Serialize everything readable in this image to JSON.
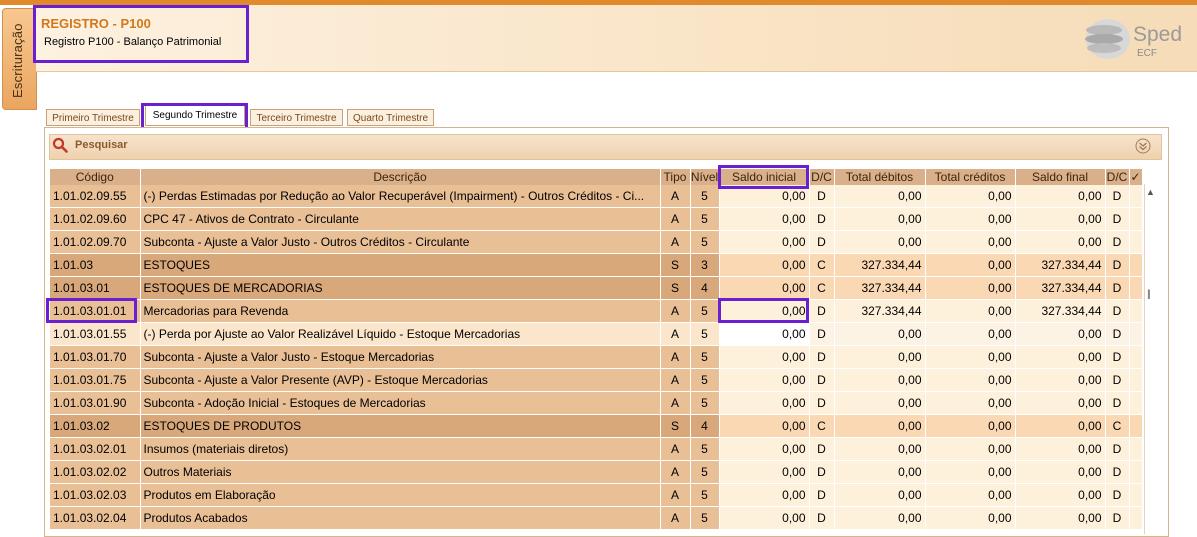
{
  "side_tab": {
    "label": "Escrituração"
  },
  "header": {
    "title": "REGISTRO - P100",
    "subtitle": "Registro P100 - Balanço Patrimonial",
    "logo_word": "Sped",
    "logo_sub": "ECF"
  },
  "tabs": [
    {
      "label": "Primeiro Trimestre",
      "active": false
    },
    {
      "label": "Segundo Trimestre",
      "active": true
    },
    {
      "label": "Terceiro Trimestre",
      "active": false
    },
    {
      "label": "Quarto Trimestre",
      "active": false
    }
  ],
  "search": {
    "label": "Pesquisar"
  },
  "table": {
    "columns": [
      "Código",
      "Descrição",
      "Tipo",
      "Nível",
      "Saldo inicial",
      "D/C",
      "Total débitos",
      "Total créditos",
      "Saldo final",
      "D/C",
      "✓"
    ],
    "rows": [
      {
        "codigo": "1.01.02.09.55",
        "descricao": "(-) Perdas Estimadas por Redução ao Valor Recuperável (Impairment) - Outros Créditos - Ci...",
        "tipo": "A",
        "nivel": "5",
        "saldo_inicial": "0,00",
        "dc1": "D",
        "total_debitos": "0,00",
        "total_creditos": "0,00",
        "saldo_final": "0,00",
        "dc2": "D",
        "style": "light"
      },
      {
        "codigo": "1.01.02.09.60",
        "descricao": "CPC 47 - Ativos de Contrato - Circulante",
        "tipo": "A",
        "nivel": "5",
        "saldo_inicial": "0,00",
        "dc1": "D",
        "total_debitos": "0,00",
        "total_creditos": "0,00",
        "saldo_final": "0,00",
        "dc2": "D",
        "style": "light"
      },
      {
        "codigo": "1.01.02.09.70",
        "descricao": "Subconta - Ajuste a Valor Justo - Outros Créditos - Circulante",
        "tipo": "A",
        "nivel": "5",
        "saldo_inicial": "0,00",
        "dc1": "D",
        "total_debitos": "0,00",
        "total_creditos": "0,00",
        "saldo_final": "0,00",
        "dc2": "D",
        "style": "light"
      },
      {
        "codigo": "1.01.03",
        "descricao": "ESTOQUES",
        "tipo": "S",
        "nivel": "3",
        "saldo_inicial": "0,00",
        "dc1": "C",
        "total_debitos": "327.334,44",
        "total_creditos": "0,00",
        "saldo_final": "327.334,44",
        "dc2": "D",
        "style": "dark"
      },
      {
        "codigo": "1.01.03.01",
        "descricao": "ESTOQUES DE MERCADORIAS",
        "tipo": "S",
        "nivel": "4",
        "saldo_inicial": "0,00",
        "dc1": "C",
        "total_debitos": "327.334,44",
        "total_creditos": "0,00",
        "saldo_final": "327.334,44",
        "dc2": "D",
        "style": "dark"
      },
      {
        "codigo": "1.01.03.01.01",
        "descricao": "Mercadorias para Revenda",
        "tipo": "A",
        "nivel": "5",
        "saldo_inicial": "0,00",
        "dc1": "D",
        "total_debitos": "327.334,44",
        "total_creditos": "0,00",
        "saldo_final": "327.334,44",
        "dc2": "D",
        "style": "light"
      },
      {
        "codigo": "1.01.03.01.55",
        "descricao": "(-) Perda por Ajuste ao Valor Realizável Líquido - Estoque Mercadorias",
        "tipo": "A",
        "nivel": "5",
        "saldo_inicial": "0,00",
        "dc1": "D",
        "total_debitos": "0,00",
        "total_creditos": "0,00",
        "saldo_final": "0,00",
        "dc2": "D",
        "style": "sel"
      },
      {
        "codigo": "1.01.03.01.70",
        "descricao": "Subconta - Ajuste a Valor Justo - Estoque Mercadorias",
        "tipo": "A",
        "nivel": "5",
        "saldo_inicial": "0,00",
        "dc1": "D",
        "total_debitos": "0,00",
        "total_creditos": "0,00",
        "saldo_final": "0,00",
        "dc2": "D",
        "style": "light"
      },
      {
        "codigo": "1.01.03.01.75",
        "descricao": "Subconta - Ajuste a Valor Presente (AVP) -  Estoque Mercadorias",
        "tipo": "A",
        "nivel": "5",
        "saldo_inicial": "0,00",
        "dc1": "D",
        "total_debitos": "0,00",
        "total_creditos": "0,00",
        "saldo_final": "0,00",
        "dc2": "D",
        "style": "light"
      },
      {
        "codigo": "1.01.03.01.90",
        "descricao": "Subconta - Adoção Inicial -  Estoques de Mercadorias",
        "tipo": "A",
        "nivel": "5",
        "saldo_inicial": "0,00",
        "dc1": "D",
        "total_debitos": "0,00",
        "total_creditos": "0,00",
        "saldo_final": "0,00",
        "dc2": "D",
        "style": "light"
      },
      {
        "codigo": "1.01.03.02",
        "descricao": "ESTOQUES DE PRODUTOS",
        "tipo": "S",
        "nivel": "4",
        "saldo_inicial": "0,00",
        "dc1": "C",
        "total_debitos": "0,00",
        "total_creditos": "0,00",
        "saldo_final": "0,00",
        "dc2": "C",
        "style": "dark"
      },
      {
        "codigo": "1.01.03.02.01",
        "descricao": "Insumos (materiais diretos)",
        "tipo": "A",
        "nivel": "5",
        "saldo_inicial": "0,00",
        "dc1": "D",
        "total_debitos": "0,00",
        "total_creditos": "0,00",
        "saldo_final": "0,00",
        "dc2": "D",
        "style": "light"
      },
      {
        "codigo": "1.01.03.02.02",
        "descricao": "Outros Materiais",
        "tipo": "A",
        "nivel": "5",
        "saldo_inicial": "0,00",
        "dc1": "D",
        "total_debitos": "0,00",
        "total_creditos": "0,00",
        "saldo_final": "0,00",
        "dc2": "D",
        "style": "light"
      },
      {
        "codigo": "1.01.03.02.03",
        "descricao": "Produtos em Elaboração",
        "tipo": "A",
        "nivel": "5",
        "saldo_inicial": "0,00",
        "dc1": "D",
        "total_debitos": "0,00",
        "total_creditos": "0,00",
        "saldo_final": "0,00",
        "dc2": "D",
        "style": "light"
      },
      {
        "codigo": "1.01.03.02.04",
        "descricao": "Produtos Acabados",
        "tipo": "A",
        "nivel": "5",
        "saldo_inicial": "0,00",
        "dc1": "D",
        "total_debitos": "0,00",
        "total_creditos": "0,00",
        "saldo_final": "0,00",
        "dc2": "D",
        "style": "light"
      }
    ]
  }
}
